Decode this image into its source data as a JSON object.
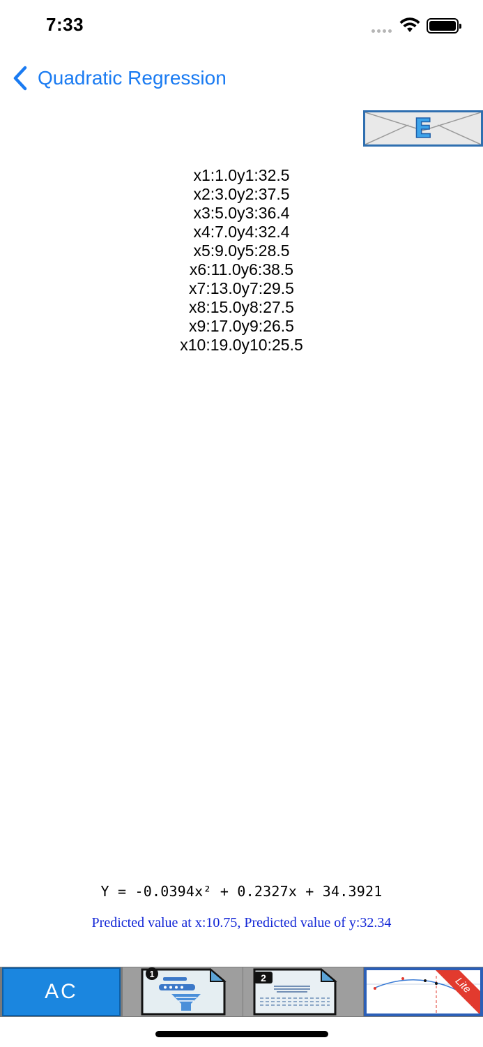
{
  "status_bar": {
    "time": "7:33"
  },
  "nav": {
    "back_label": "Quadratic Regression"
  },
  "email_button": {
    "letter": "E"
  },
  "data_points": [
    {
      "x_label": "x1:",
      "x": "1.0",
      "y_label": "y1:",
      "y": "32.5"
    },
    {
      "x_label": "x2:",
      "x": "3.0",
      "y_label": "y2:",
      "y": "37.5"
    },
    {
      "x_label": "x3:",
      "x": "5.0",
      "y_label": "y3:",
      "y": "36.4"
    },
    {
      "x_label": "x4:",
      "x": "7.0",
      "y_label": "y4:",
      "y": "32.4"
    },
    {
      "x_label": "x5:",
      "x": "9.0",
      "y_label": "y5:",
      "y": "28.5"
    },
    {
      "x_label": "x6:",
      "x": "11.0",
      "y_label": "y6:",
      "y": "38.5"
    },
    {
      "x_label": "x7:",
      "x": "13.0",
      "y_label": "y7:",
      "y": "29.5"
    },
    {
      "x_label": "x8:",
      "x": "15.0",
      "y_label": "y8:",
      "y": "27.5"
    },
    {
      "x_label": "x9:",
      "x": "17.0",
      "y_label": "y9:",
      "y": "26.5"
    },
    {
      "x_label": "x10:",
      "x": "19.0",
      "y_label": "y10:",
      "y": "25.5"
    }
  ],
  "equation": "Y = -0.0394x² + 0.2327x + 34.3921",
  "predicted": "Predicted value at x:10.75, Predicted value of y:32.34",
  "toolbar": {
    "ac_label": "AC",
    "doc1_badge": "1",
    "doc2_badge": "2",
    "lite_label": "Lite"
  },
  "colors": {
    "accent_blue": "#1a7bf2",
    "predicted_text": "#1226d6",
    "ac_button": "#1b86df",
    "lite_ribbon": "#e23a2e"
  }
}
